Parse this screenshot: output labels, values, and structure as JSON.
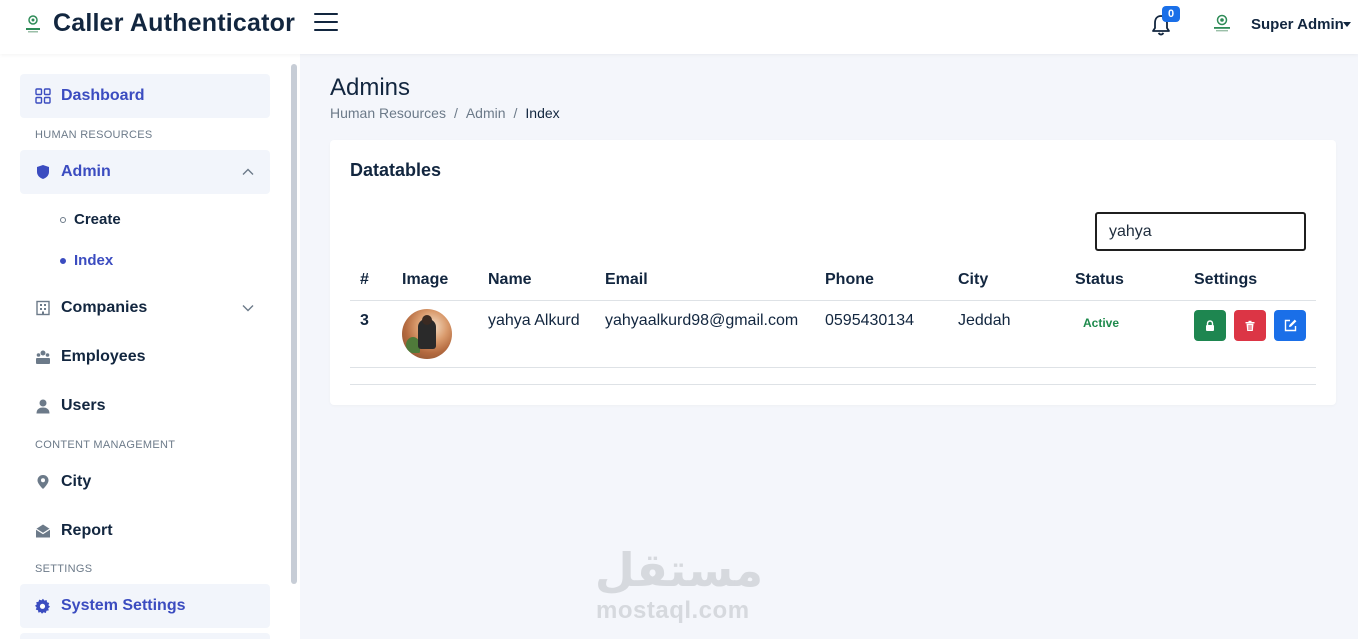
{
  "header": {
    "app_title": "Caller Authenticator",
    "notification_count": "0",
    "user_name": "Super Admin"
  },
  "sidebar": {
    "dashboard": "Dashboard",
    "sections": {
      "hr": "HUMAN RESOURCES",
      "content": "CONTENT MANAGEMENT",
      "settings": "SETTINGS"
    },
    "admin": "Admin",
    "admin_sub": {
      "create": "Create",
      "index": "Index"
    },
    "companies": "Companies",
    "employees": "Employees",
    "users": "Users",
    "city": "City",
    "report": "Report",
    "system_settings": "System Settings"
  },
  "page": {
    "title": "Admins",
    "breadcrumb": [
      "Human Resources",
      "Admin",
      "Index"
    ]
  },
  "card": {
    "title": "Datatables",
    "search_value": "yahya",
    "columns": [
      "#",
      "Image",
      "Name",
      "Email",
      "Phone",
      "City",
      "Status",
      "Settings"
    ],
    "rows": [
      {
        "id": "3",
        "name": "yahya Alkurd",
        "email": "yahyaalkurd98@gmail.com",
        "phone": "0595430134",
        "city": "Jeddah",
        "status": "Active"
      }
    ]
  },
  "watermark": {
    "arabic": "مستقل",
    "latin": "mostaql.com"
  },
  "colors": {
    "primary": "#3b4cc0",
    "success": "#1e8650",
    "danger": "#dc3545",
    "info": "#1a6fe8",
    "dark": "#12263f"
  }
}
